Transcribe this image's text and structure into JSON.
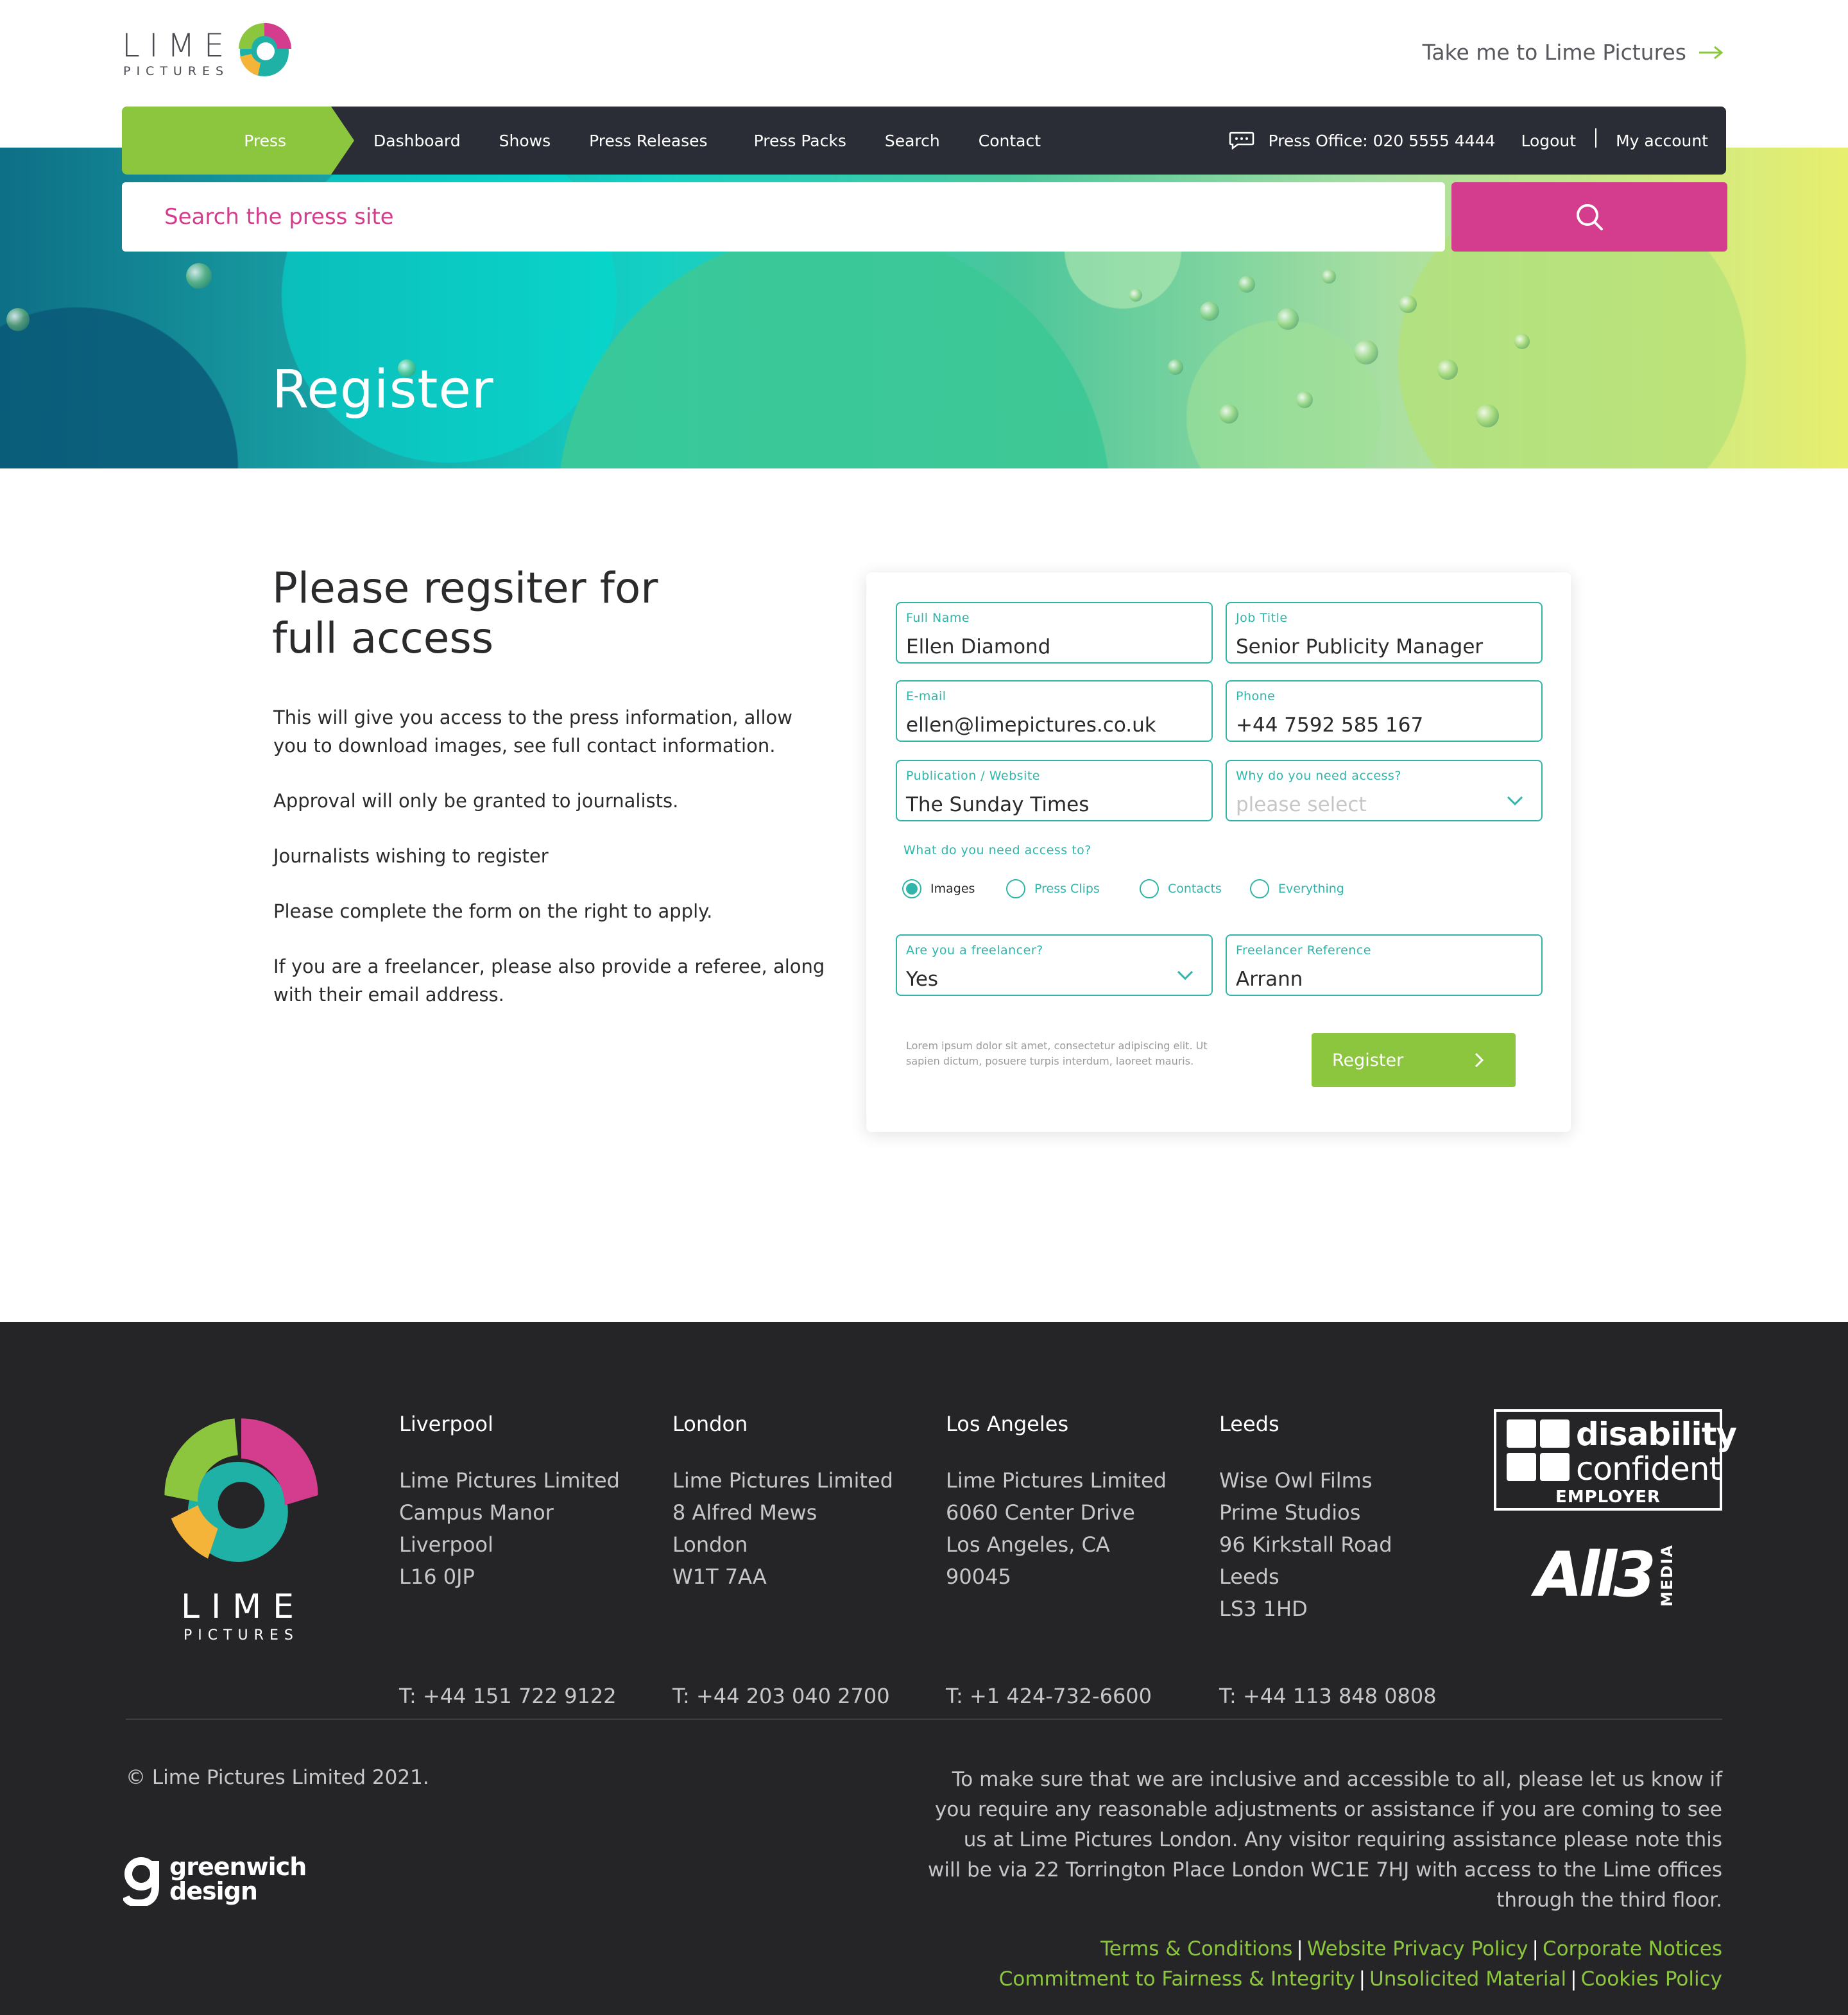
{
  "header": {
    "logo_word": "LIME",
    "logo_sub": "PICTURES",
    "take_me": "Take me to Lime Pictures",
    "take_me_icon": "arrow-right-icon"
  },
  "nav": {
    "press": "Press",
    "items": [
      "Dashboard",
      "Shows",
      "Press Releases",
      "Press Packs",
      "Search",
      "Contact"
    ],
    "press_office": "Press Office: 020 5555 4444",
    "logout": "Logout",
    "my_account": "My account"
  },
  "search": {
    "placeholder": "Search the press site",
    "button_icon": "search-icon"
  },
  "hero": {
    "title": "Register"
  },
  "intro": {
    "title_line1": "Please regsiter for",
    "title_line2": "full access",
    "paragraphs": [
      "This will give you access to the press information, allow you to download images, see full contact information.",
      "Approval will only be granted to journalists.",
      "Journalists wishing to register",
      "Please complete the form on the right to apply.",
      "If you are a freelancer, please also provide a referee, along with their email address."
    ]
  },
  "form": {
    "full_name": {
      "label": "Full Name",
      "value": "Ellen Diamond"
    },
    "job_title": {
      "label": "Job Title",
      "value": "Senior Publicity Manager"
    },
    "email": {
      "label": "E-mail",
      "value": "ellen@limepictures.co.uk"
    },
    "phone": {
      "label": "Phone",
      "value": "+44  7592 585 167"
    },
    "publication": {
      "label": "Publication / Website",
      "value": "The Sunday Times"
    },
    "why_access": {
      "label": "Why do you need access?",
      "placeholder": "please select"
    },
    "access_question": "What do you need access to?",
    "access_options": [
      {
        "label": "Images",
        "checked": true
      },
      {
        "label": "Press Clips",
        "checked": false
      },
      {
        "label": "Contacts",
        "checked": false
      },
      {
        "label": "Everything",
        "checked": false
      }
    ],
    "freelancer": {
      "label": "Are you a freelancer?",
      "value": "Yes"
    },
    "freelancer_ref": {
      "label": "Freelancer Reference",
      "value": "Arrann"
    },
    "legal": "Lorem ipsum dolor sit amet, consectetur adipiscing elit. Ut sapien dictum, posuere turpis interdum, laoreet mauris.",
    "register": "Register"
  },
  "footer": {
    "logo_word": "LIME",
    "logo_sub": "PICTURES",
    "offices": [
      {
        "city": "Liverpool",
        "lines": [
          "Lime Pictures Limited",
          "Campus Manor",
          "Liverpool",
          "L16 0JP"
        ],
        "tel": "T: +44 151 722 9122"
      },
      {
        "city": "London",
        "lines": [
          "Lime Pictures Limited",
          "8 Alfred Mews",
          "London",
          "W1T 7AA"
        ],
        "tel": "T: +44 203 040 2700"
      },
      {
        "city": "Los Angeles",
        "lines": [
          "Lime Pictures Limited",
          "6060 Center Drive",
          "Los Angeles, CA",
          "90045"
        ],
        "tel": "T: +1 424-732-6600"
      },
      {
        "city": "Leeds",
        "lines": [
          "Wise Owl Films",
          "Prime Studios",
          "96 Kirkstall Road",
          "Leeds",
          "LS3 1HD"
        ],
        "tel": "T: +44 113 848 0808"
      }
    ],
    "badge": {
      "line1": "disability",
      "line2": "confident",
      "line3": "EMPLOYER"
    },
    "all3": {
      "main": "All3",
      "media": "MEDIA"
    },
    "copyright": "© Lime Pictures Limited 2021.",
    "greenwich": {
      "line1": "greenwich",
      "line2": "design"
    },
    "access_note": "To make sure that we are inclusive and accessible to all, please let us know if you require any reasonable adjustments or assistance if you are coming to see us at Lime Pictures London. Any visitor requiring assistance please note this will be via 22 Torrington Place London WC1E 7HJ with access to the Lime offices through the third floor.",
    "links_row1": [
      "Terms & Conditions",
      "Website Privacy Policy",
      "Corporate Notices"
    ],
    "links_row2": [
      "Commitment to Fairness & Integrity",
      "Unsolicited Material",
      "Cookies Policy"
    ]
  },
  "colors": {
    "lime_green": "#8cc63f",
    "magenta": "#d43c8d",
    "teal": "#2fb5aa",
    "nav_dark": "#2a2d35",
    "footer_dark": "#252527"
  }
}
